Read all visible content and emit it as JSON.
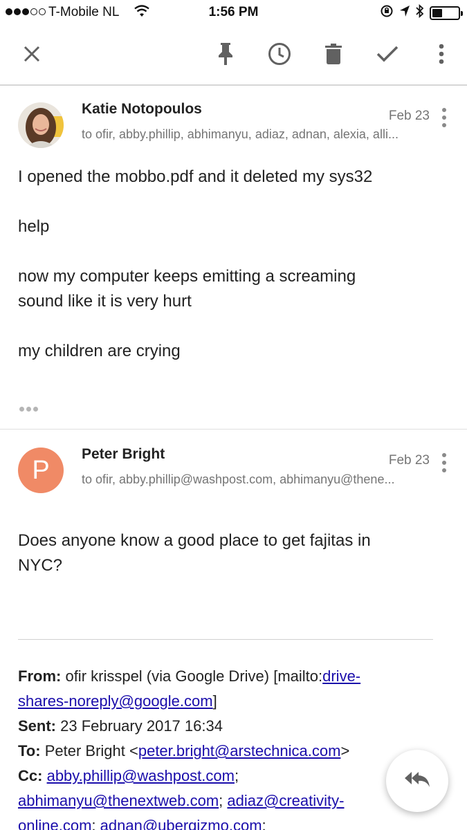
{
  "status_bar": {
    "carrier": "T-Mobile NL",
    "time": "1:56 PM",
    "signal_bars": 3,
    "battery_level": 0.4
  },
  "toolbar": {
    "icons": [
      "close-icon",
      "pin-icon",
      "snooze-clock-icon",
      "trash-icon",
      "done-check-icon",
      "more-vert-icon"
    ]
  },
  "messages": [
    {
      "sender": "Katie Notopoulos",
      "recipients": "to ofir, abby.phillip, abhimanyu, adiaz, adnan, alexia, alli...",
      "date": "Feb 23",
      "avatar": "photo",
      "body": [
        "I opened the mobbo.pdf and it deleted my sys32",
        "help",
        "now my computer keeps emitting a screaming",
        "sound like it is very hurt",
        "my children are crying"
      ]
    },
    {
      "sender": "Peter Bright",
      "recipients": "to ofir, abby.phillip@washpost.com, abhimanyu@thene...",
      "date": "Feb 23",
      "avatar_letter": "P",
      "avatar_color": "#f08a66",
      "body": [
        "Does anyone know a good place to get fajitas in",
        "NYC?"
      ]
    }
  ],
  "quoted": {
    "from_label": "From:",
    "from_text": "ofir krisspel (via Google Drive) [mailto:",
    "from_link_1": "drive-",
    "from_link_2": "shares-noreply@google.com",
    "from_close": "]",
    "sent_label": "Sent:",
    "sent_value": "23 February 2017 16:34",
    "to_label": "To:",
    "to_name": "Peter Bright <",
    "to_email": "peter.bright@arstechnica.com",
    "to_close": ">",
    "cc_label": "Cc:",
    "cc_1": "abby.phillip@washpost.com",
    "cc_sep_1": ";",
    "cc_2": "abhimanyu@thenextweb.com",
    "cc_sep_2": ";",
    "cc_3a": "adiaz@creativity-",
    "cc_3b": "online.com",
    "cc_sep_3": ";",
    "cc_4": "adnan@ubergizmo.com",
    "cc_sep_4": ";"
  },
  "fab": {
    "icon": "reply-all-icon"
  },
  "colors": {
    "link": "#1a0dab",
    "avatar_p": "#f08a66"
  }
}
